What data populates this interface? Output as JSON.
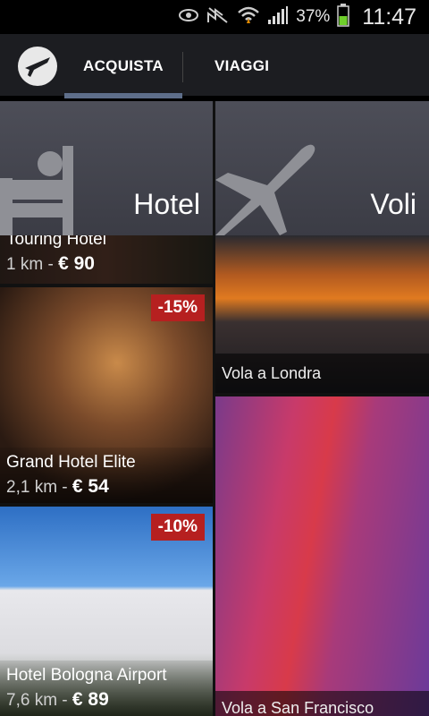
{
  "status_bar": {
    "battery_percent": "37%",
    "time": "11:47",
    "icons": [
      "eye-icon",
      "no-signal-icon",
      "wifi-icon",
      "signal-icon",
      "battery-icon"
    ]
  },
  "action_bar": {
    "tabs": [
      {
        "label": "ACQUISTA",
        "selected": true
      },
      {
        "label": "VIAGGI",
        "selected": false
      }
    ],
    "accent_color": "#5e6e8a"
  },
  "sections": {
    "hotel": {
      "label": "Hotel"
    },
    "flights": {
      "label": "Voli"
    }
  },
  "hotels": [
    {
      "name": "Touring Hotel",
      "distance": "1 km",
      "price": "€ 90"
    },
    {
      "name": "Grand Hotel Elite",
      "distance": "2,1 km",
      "price": "€ 54",
      "discount": "-15%"
    },
    {
      "name": "Hotel Bologna Airport",
      "distance": "7,6 km",
      "price": "€ 89",
      "discount": "-10%"
    }
  ],
  "flights": [
    {
      "label": "Vola a Londra"
    },
    {
      "label": "Vola a San Francisco"
    }
  ],
  "colors": {
    "discount_badge": "#b62020",
    "header_tile": "#45464f"
  }
}
